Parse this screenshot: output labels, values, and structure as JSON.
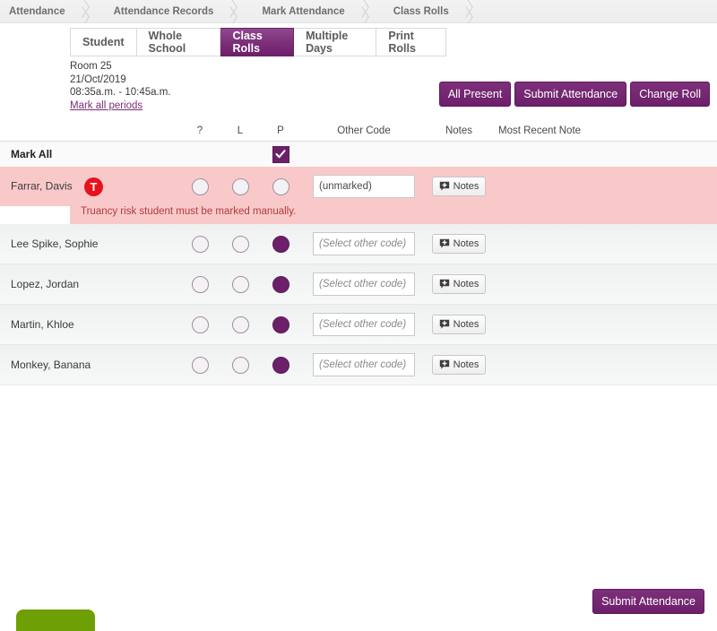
{
  "breadcrumb": {
    "items": [
      {
        "label": "Attendance"
      },
      {
        "label": "Attendance Records"
      },
      {
        "label": "Mark Attendance"
      },
      {
        "label": "Class Rolls"
      }
    ]
  },
  "tabs": [
    {
      "label": "Student",
      "active": false
    },
    {
      "label": "Whole School",
      "active": false
    },
    {
      "label": "Class Rolls",
      "active": true
    },
    {
      "label": "Multiple Days",
      "active": false
    },
    {
      "label": "Print Rolls",
      "active": false
    }
  ],
  "roll_info": {
    "room": "Room 25",
    "date": "21/Oct/2019",
    "time": "08:35a.m. - 10:45a.m.",
    "mark_all_periods_link": "Mark all periods"
  },
  "actions": {
    "all_present": "All Present",
    "submit_attendance": "Submit Attendance",
    "change_roll": "Change Roll"
  },
  "table": {
    "headers": {
      "question": "?",
      "late": "L",
      "present": "P",
      "other_code": "Other Code",
      "notes": "Notes",
      "most_recent_note": "Most Recent Note"
    },
    "mark_all_label": "Mark All",
    "mark_all_checked": true,
    "notes_button_label": "Notes",
    "other_code_placeholder": "(Select other code)",
    "rows": [
      {
        "name": "Farrar, Davis",
        "truancy_badge": "T",
        "question_selected": false,
        "late_selected": false,
        "present_selected": false,
        "other_code_value": "(unmarked)",
        "alert": true,
        "alert_message": "Truancy risk student must be marked manually."
      },
      {
        "name": "Lee Spike, Sophie",
        "question_selected": false,
        "late_selected": false,
        "present_selected": true,
        "other_code_value": "",
        "alert": false
      },
      {
        "name": "Lopez, Jordan",
        "question_selected": false,
        "late_selected": false,
        "present_selected": true,
        "other_code_value": "",
        "alert": false
      },
      {
        "name": "Martin, Khloe",
        "question_selected": false,
        "late_selected": false,
        "present_selected": true,
        "other_code_value": "",
        "alert": false
      },
      {
        "name": "Monkey, Banana",
        "question_selected": false,
        "late_selected": false,
        "present_selected": true,
        "other_code_value": "",
        "alert": false
      }
    ]
  },
  "footer": {
    "submit_attendance": "Submit Attendance"
  },
  "colors": {
    "accent_purple": "#6d1f6b",
    "alert_red": "#e8121b",
    "alert_row_bg": "#f9c9ca",
    "green_tab": "#6ea005"
  }
}
